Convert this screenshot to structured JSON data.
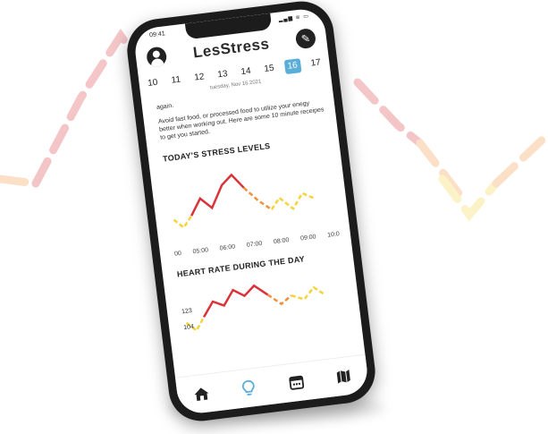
{
  "status_bar": {
    "time": "09:41",
    "icons": "▂▄▆ ≋ ▭"
  },
  "header": {
    "logo": "LesStress",
    "avatar_icon": "user-icon",
    "settings_icon": "wrench-icon"
  },
  "date_strip": {
    "days": [
      "10",
      "11",
      "12",
      "13",
      "14",
      "15",
      "16",
      "17"
    ],
    "selected": "16",
    "subtitle": "tuesday, Nov 16 2021"
  },
  "tips": {
    "intro": "again.",
    "text": "Avoid fast food, or processed food to utilize your enegy better when working out. Here are some 10 minute receipes to get you started."
  },
  "stress_section": {
    "title": "TODAY'S STRESS LEVELS",
    "time_labels": [
      "00",
      "05:00",
      "06:00",
      "07:00",
      "08:00",
      "09:00",
      "10:0"
    ]
  },
  "heart_section": {
    "title": "HEART RATE DURING THE DAY",
    "axis_labels": [
      "123",
      "104"
    ]
  },
  "bottom_nav": [
    {
      "name": "home",
      "icon": "home-icon"
    },
    {
      "name": "tips",
      "icon": "lightbulb-icon"
    },
    {
      "name": "calendar",
      "icon": "calendar-icon"
    },
    {
      "name": "map",
      "icon": "map-icon"
    }
  ],
  "colors": {
    "red": "#d9333a",
    "orange": "#f2903a",
    "yellow": "#f5d33a",
    "accent_blue": "#5aaed8",
    "phone_frame": "#1c1c1c"
  }
}
